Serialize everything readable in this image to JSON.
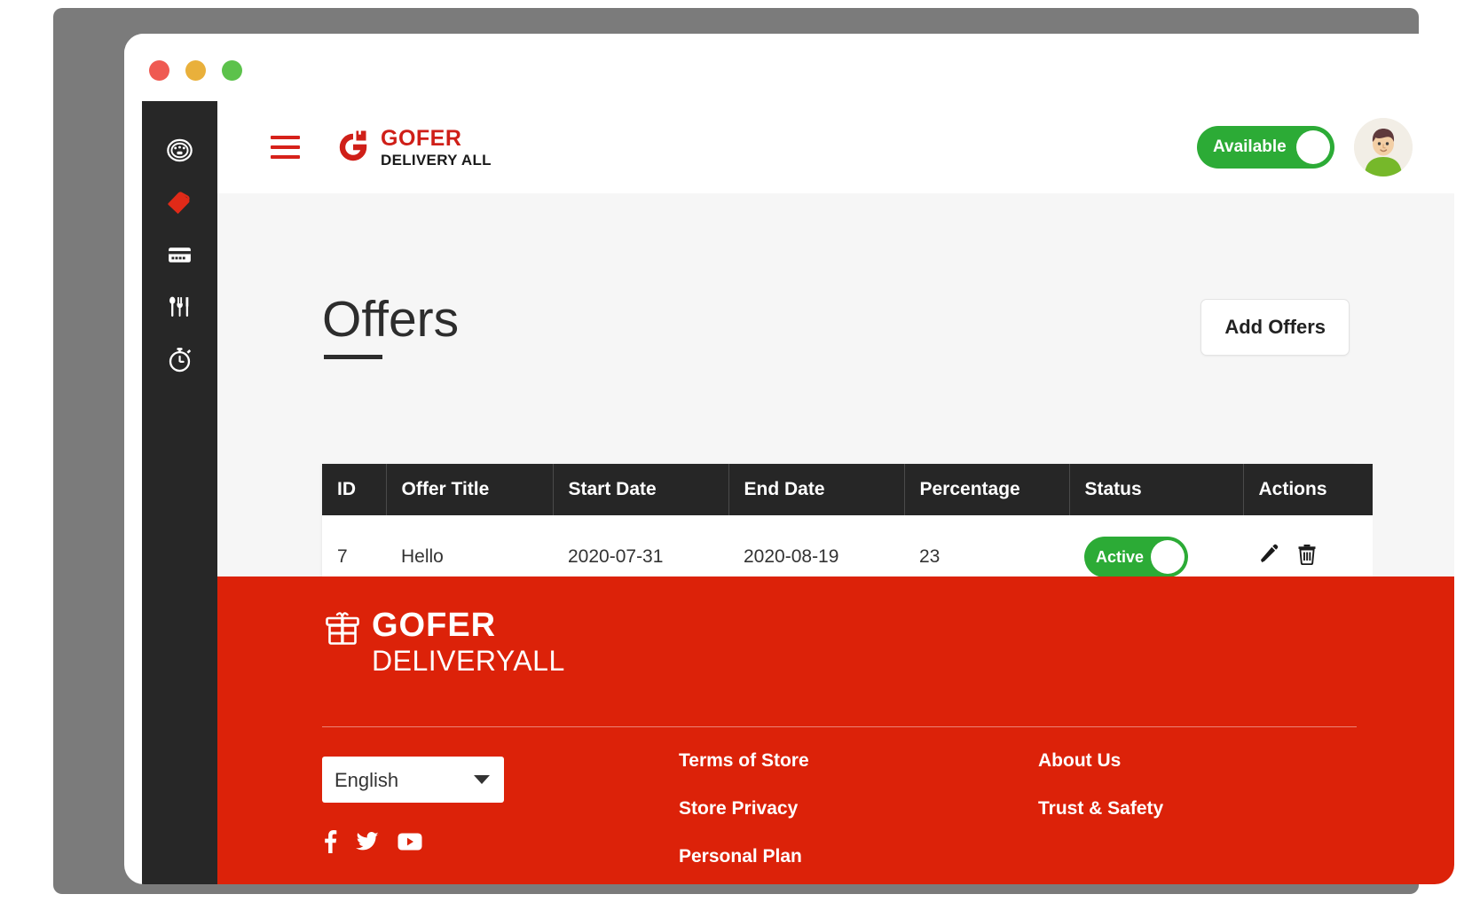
{
  "window": {
    "dots": [
      "close",
      "minimize",
      "maximize"
    ]
  },
  "header": {
    "menu_icon": "hamburger-menu-icon",
    "brand_line1": "GOFER",
    "brand_line2": "DELIVERY ALL",
    "availability_label": "Available",
    "availability_on": true,
    "avatar_alt": "user-avatar"
  },
  "sidebar": {
    "items": [
      {
        "icon": "dashboard-speedometer-icon",
        "name": "dashboard",
        "active": false
      },
      {
        "icon": "tag-offer-icon",
        "name": "offers",
        "active": true
      },
      {
        "icon": "credit-card-icon",
        "name": "payments",
        "active": false
      },
      {
        "icon": "cutlery-icon",
        "name": "menu",
        "active": false
      },
      {
        "icon": "stopwatch-icon",
        "name": "timings",
        "active": false
      }
    ]
  },
  "main": {
    "title": "Offers",
    "add_button_label": "Add Offers",
    "table": {
      "columns": [
        "ID",
        "Offer Title",
        "Start Date",
        "End Date",
        "Percentage",
        "Status",
        "Actions"
      ],
      "rows": [
        {
          "id": "7",
          "title": "Hello",
          "start_date": "2020-07-31",
          "end_date": "2020-08-19",
          "percentage": "23",
          "status_label": "Active",
          "status_on": true,
          "actions": [
            "edit-pencil-icon",
            "delete-trash-icon"
          ]
        }
      ]
    }
  },
  "footer": {
    "logo_line1": "GOFER",
    "logo_line2": "DELIVERYALL",
    "language_selected": "English",
    "language_options": [
      "English"
    ],
    "links_col1": [
      "Terms of Store",
      "Store Privacy",
      "Personal Plan"
    ],
    "links_col2": [
      "About Us",
      "Trust & Safety"
    ],
    "socials": [
      "facebook-icon",
      "twitter-icon",
      "youtube-icon"
    ]
  },
  "colors": {
    "brand_red": "#cf1f18",
    "footer_red": "#dc2209",
    "toggle_green": "#2cab36",
    "sidebar_dark": "#272727",
    "table_head": "#262626"
  }
}
